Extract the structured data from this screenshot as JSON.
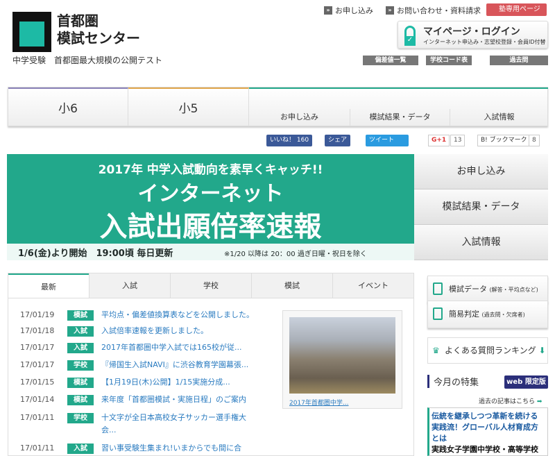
{
  "header": {
    "logo_line1": "首都圏",
    "logo_line2": "模試センター",
    "tagline": "中学受験　首都圏最大規模の公開テスト",
    "top_links": [
      "お申し込み",
      "お問い合わせ・資料請求"
    ],
    "juku": "塾専用ページ",
    "login_title": "マイページ・ログイン",
    "login_sub": "インターネット申込み・志望校登録・会員ID付替",
    "gray_buttons": [
      "偏差値一覧",
      "学校コード表",
      "過去問"
    ]
  },
  "nav": {
    "grade6": "小6",
    "grade5": "小5",
    "subs": [
      "お申し込み",
      "模試結果・データ",
      "入試情報"
    ]
  },
  "social": {
    "like": "いいね！ 160",
    "share": "シェア",
    "tweet": "ツイート",
    "gplus": "G+1",
    "gplus_count": "13",
    "hatena": "B! ブックマーク",
    "hatena_count": "8"
  },
  "banner": {
    "line1": "2017年 中学入試動向を素早くキャッチ!!",
    "line2": "インターネット",
    "line3": "入試出願倍率速報",
    "foot1": "1/6(金)より開始　19:00頃 毎日更新",
    "foot2": "※1/20 以降は 20：00 過ぎ日曜・祝日を除く"
  },
  "side_menu": [
    "お申し込み",
    "模試結果・データ",
    "入試情報"
  ],
  "tabs": [
    "最新",
    "入試",
    "学校",
    "模試",
    "イベント"
  ],
  "news": [
    {
      "date": "17/01/19",
      "tag": "模試",
      "text": "平均点・偏差値換算表などを公開しました。"
    },
    {
      "date": "17/01/18",
      "tag": "入試",
      "text": "入試倍率速報を更新しました。"
    },
    {
      "date": "17/01/17",
      "tag": "入試",
      "text": "2017年首都圏中学入試では165校が従..."
    },
    {
      "date": "17/01/17",
      "tag": "学校",
      "text": "『帰国生入試NAVI』に渋谷教育学園幕張..."
    },
    {
      "date": "17/01/15",
      "tag": "模試",
      "text": "【1月19日(木)公開】1/15実施分成..."
    },
    {
      "date": "17/01/14",
      "tag": "模試",
      "text": "来年度「首都圏模試・実施日程」のご案内"
    },
    {
      "date": "17/01/11",
      "tag": "学校",
      "text": "十文字が全日本高校女子サッカー選手権大会..."
    },
    {
      "date": "17/01/11",
      "tag": "入試",
      "text": "習い事受験生集まれ!いまからでも間に合"
    }
  ],
  "photo_caption": "2017年首都圏中学...",
  "right": {
    "mock_data": "模試データ",
    "mock_data_note": "(解答・平均点など)",
    "judge": "簡易判定",
    "judge_note": "(過去問・欠席者)",
    "ranking": "よくある質問ランキング",
    "feature": "今月の特集",
    "web": "web 限定版",
    "past": "過去の記事はこちら",
    "ad1": "伝統を継承しつつ革新を続ける",
    "ad2": "実践流！グローバル人材育成方とは",
    "ad3": "実践女子学園中学校・高等学校"
  }
}
